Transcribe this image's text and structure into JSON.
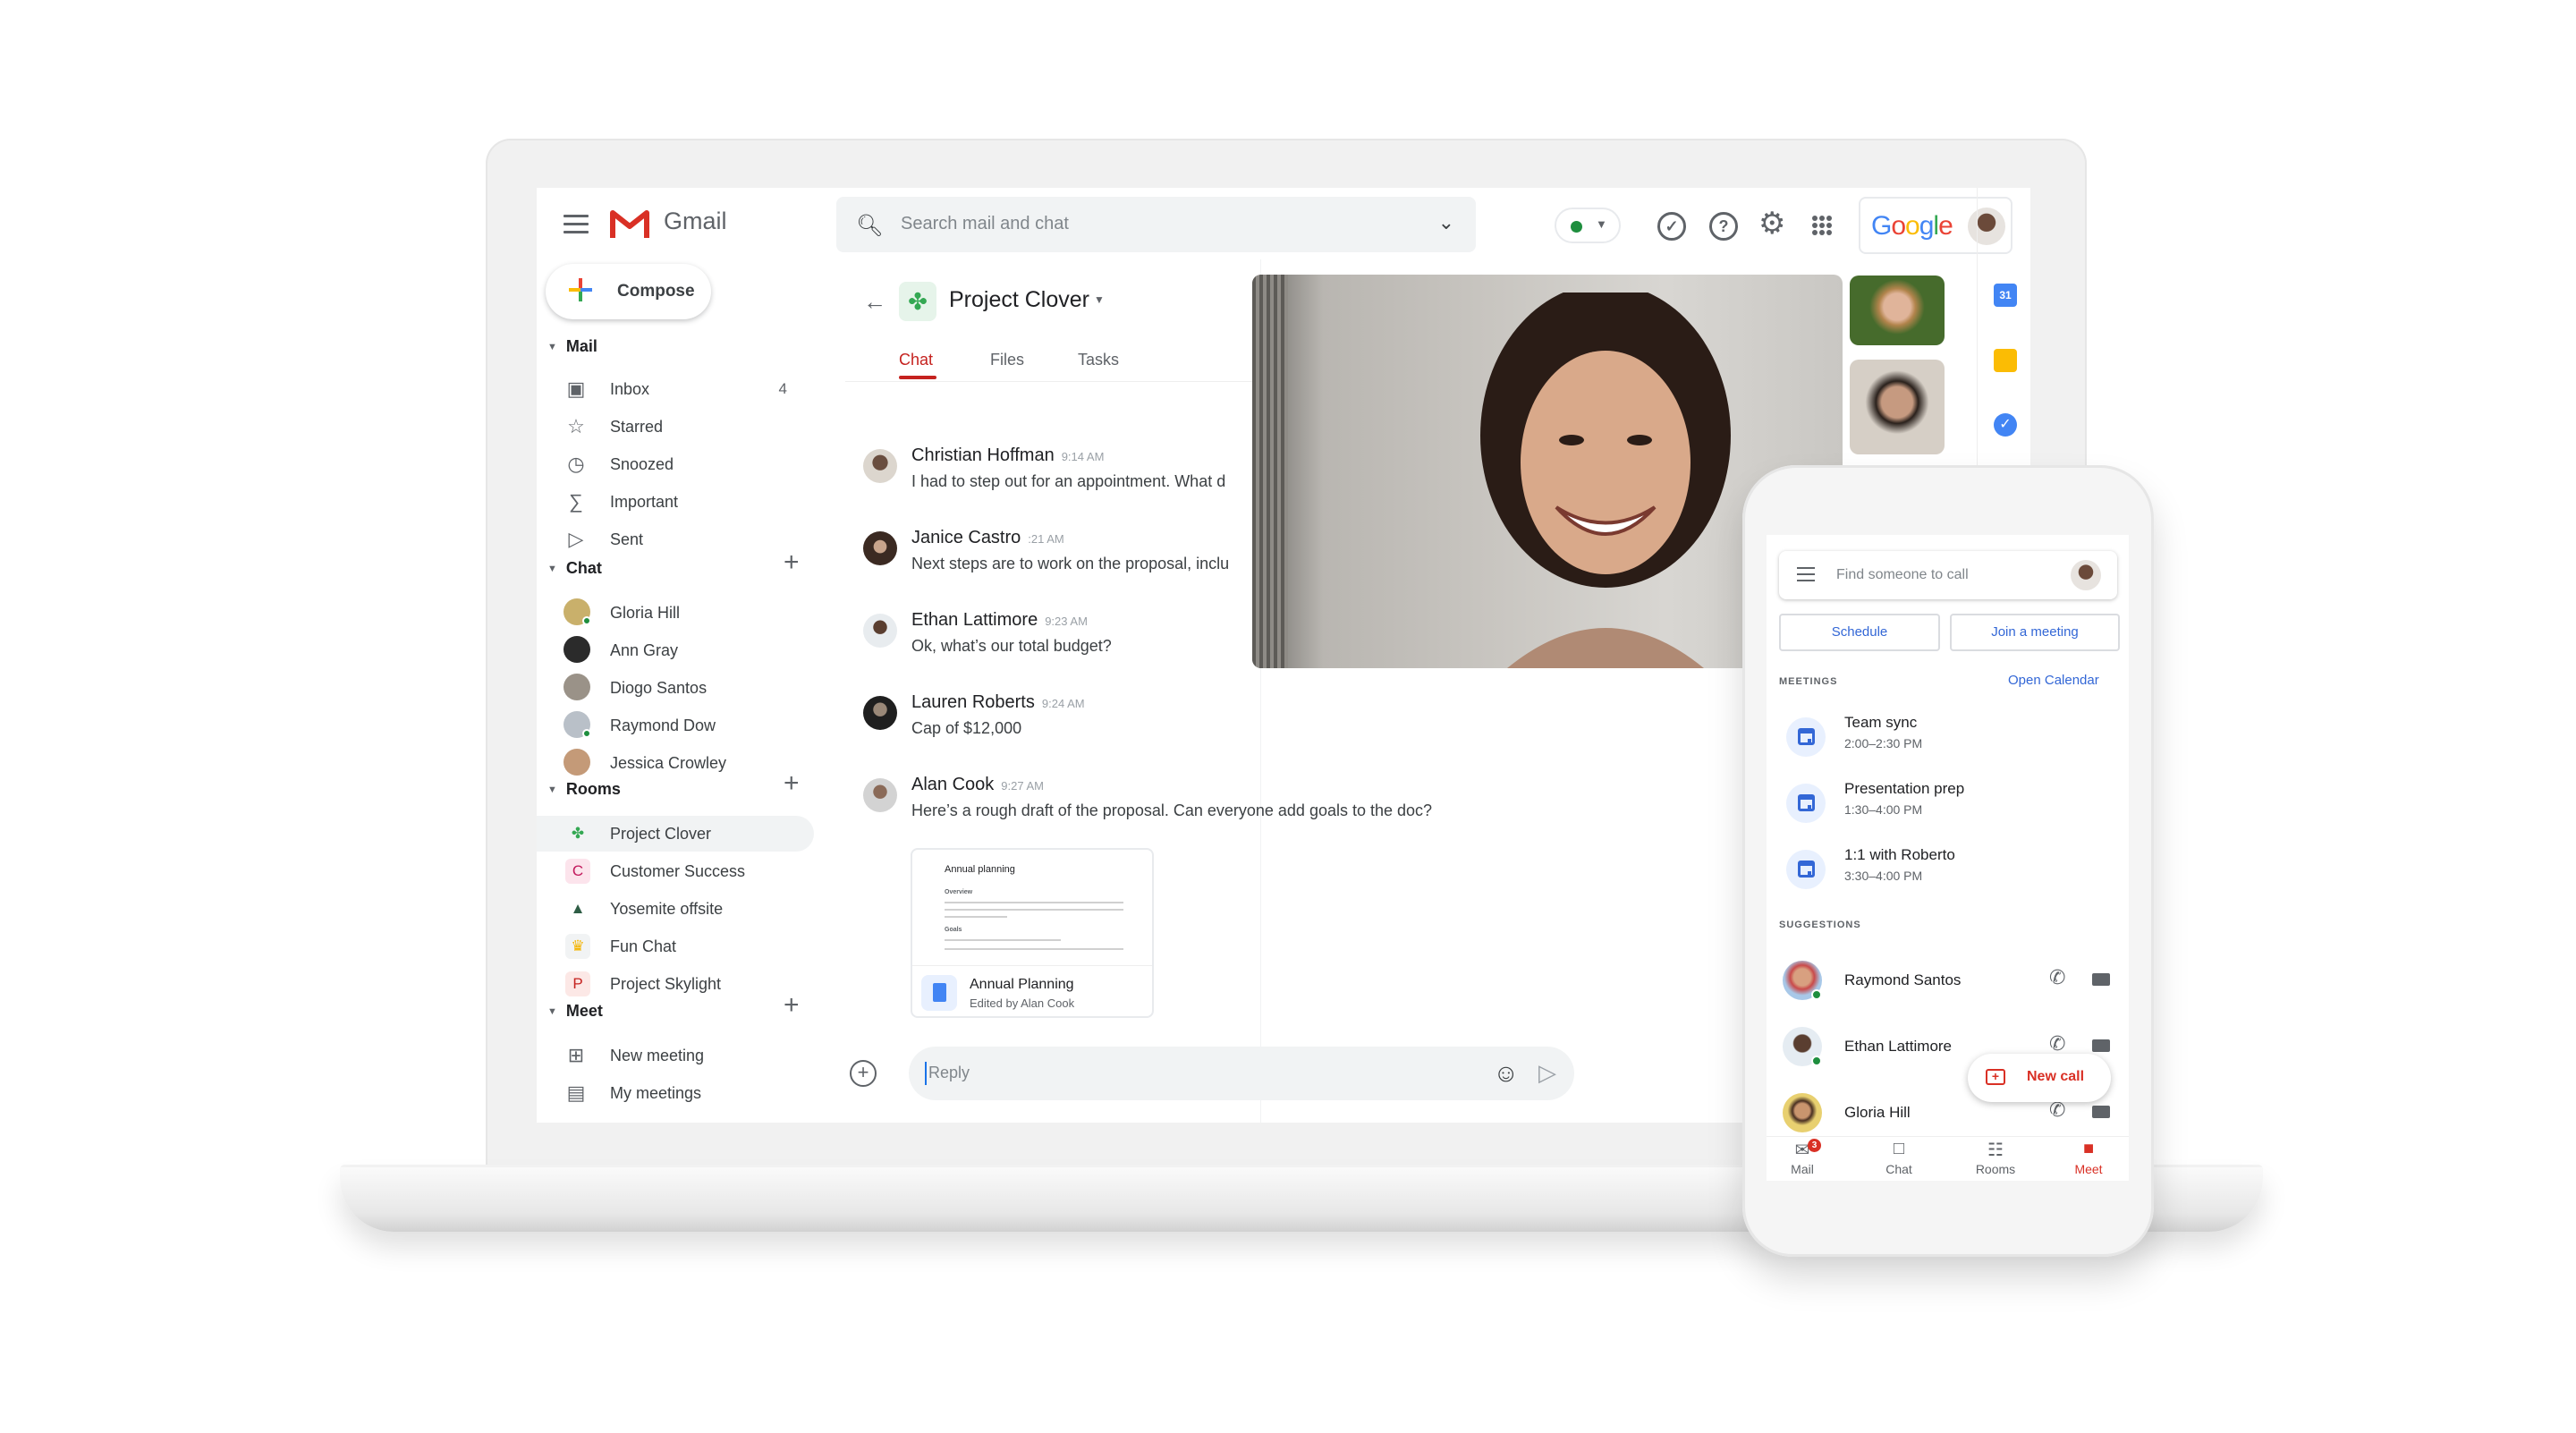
{
  "app": {
    "name": "Gmail"
  },
  "header": {
    "search_placeholder": "Search mail and chat",
    "status": "active",
    "account_brand": "Google",
    "icons": [
      "menu-icon",
      "search-icon",
      "chevron-down-icon",
      "tasks-check-icon",
      "help-icon",
      "settings-gear-icon",
      "apps-grid-icon"
    ]
  },
  "sidebar": {
    "compose_label": "Compose",
    "mail": {
      "label": "Mail",
      "items": [
        {
          "label": "Inbox",
          "count": "4",
          "icon": "inbox-icon"
        },
        {
          "label": "Starred",
          "icon": "star-icon"
        },
        {
          "label": "Snoozed",
          "icon": "clock-icon"
        },
        {
          "label": "Important",
          "icon": "important-icon"
        },
        {
          "label": "Sent",
          "icon": "send-icon"
        }
      ]
    },
    "chat": {
      "label": "Chat",
      "items": [
        {
          "label": "Gloria Hill",
          "online": true
        },
        {
          "label": "Ann Gray",
          "online": false
        },
        {
          "label": "Diogo Santos",
          "online": false
        },
        {
          "label": "Raymond Dow",
          "online": true
        },
        {
          "label": "Jessica Crowley",
          "online": false
        }
      ]
    },
    "rooms": {
      "label": "Rooms",
      "items": [
        {
          "label": "Project Clover",
          "glyph": "✤",
          "selected": true
        },
        {
          "label": "Customer Success",
          "glyph": "C"
        },
        {
          "label": "Yosemite offsite",
          "glyph": "▲"
        },
        {
          "label": "Fun Chat",
          "glyph": "♛"
        },
        {
          "label": "Project Skylight",
          "glyph": "P"
        }
      ]
    },
    "meet": {
      "label": "Meet",
      "items": [
        {
          "label": "New meeting",
          "icon": "new-video-icon"
        },
        {
          "label": "My meetings",
          "icon": "calendar-icon"
        }
      ]
    }
  },
  "room": {
    "title": "Project Clover",
    "tabs": [
      {
        "label": "Chat",
        "active": true
      },
      {
        "label": "Files",
        "active": false
      },
      {
        "label": "Tasks",
        "active": false
      }
    ],
    "messages": [
      {
        "author": "Christian Hoffman",
        "time": "9:14 AM",
        "text": "I had to step out for an appointment. What d"
      },
      {
        "author": "Janice Castro",
        "time": ":21 AM",
        "text": "Next steps are to work on the proposal, inclu"
      },
      {
        "author": "Ethan Lattimore",
        "time": "9:23 AM",
        "text": "Ok, what’s our total budget?"
      },
      {
        "author": "Lauren Roberts",
        "time": "9:24 AM",
        "text": "Cap of $12,000"
      },
      {
        "author": "Alan Cook",
        "time": "9:27 AM",
        "text": "Here’s a rough draft of the proposal. Can everyone add goals to the doc?"
      }
    ],
    "attachment": {
      "preview_title": "Annual planning",
      "preview_sections": [
        "Overview",
        "Goals"
      ],
      "title": "Annual Planning",
      "subtitle": "Edited by Alan Cook"
    },
    "reply_placeholder": "Reply"
  },
  "side_apps": [
    "calendar-icon",
    "keep-icon",
    "tasks-icon"
  ],
  "side_apps_calendar_day": "31",
  "phone": {
    "search_placeholder": "Find someone to call",
    "buttons": {
      "schedule": "Schedule",
      "join": "Join a meeting"
    },
    "meetings_label": "MEETINGS",
    "open_calendar": "Open Calendar",
    "meetings": [
      {
        "title": "Team sync",
        "time": "2:00–2:30 PM"
      },
      {
        "title": "Presentation prep",
        "time": "1:30–4:00 PM"
      },
      {
        "title": "1:1 with Roberto",
        "time": "3:30–4:00 PM"
      }
    ],
    "suggestions_label": "SUGGESTIONS",
    "suggestions": [
      {
        "name": "Raymond Santos",
        "online": true
      },
      {
        "name": "Ethan Lattimore",
        "online": true
      },
      {
        "name": "Gloria Hill",
        "online": false
      }
    ],
    "new_call": "New call",
    "nav": [
      {
        "label": "Mail",
        "badge": "3"
      },
      {
        "label": "Chat"
      },
      {
        "label": "Rooms"
      },
      {
        "label": "Meet",
        "active": true
      }
    ]
  },
  "colors": {
    "accent_red": "#c5221f",
    "link_blue": "#3367d6",
    "online_green": "#1e8e3e"
  }
}
